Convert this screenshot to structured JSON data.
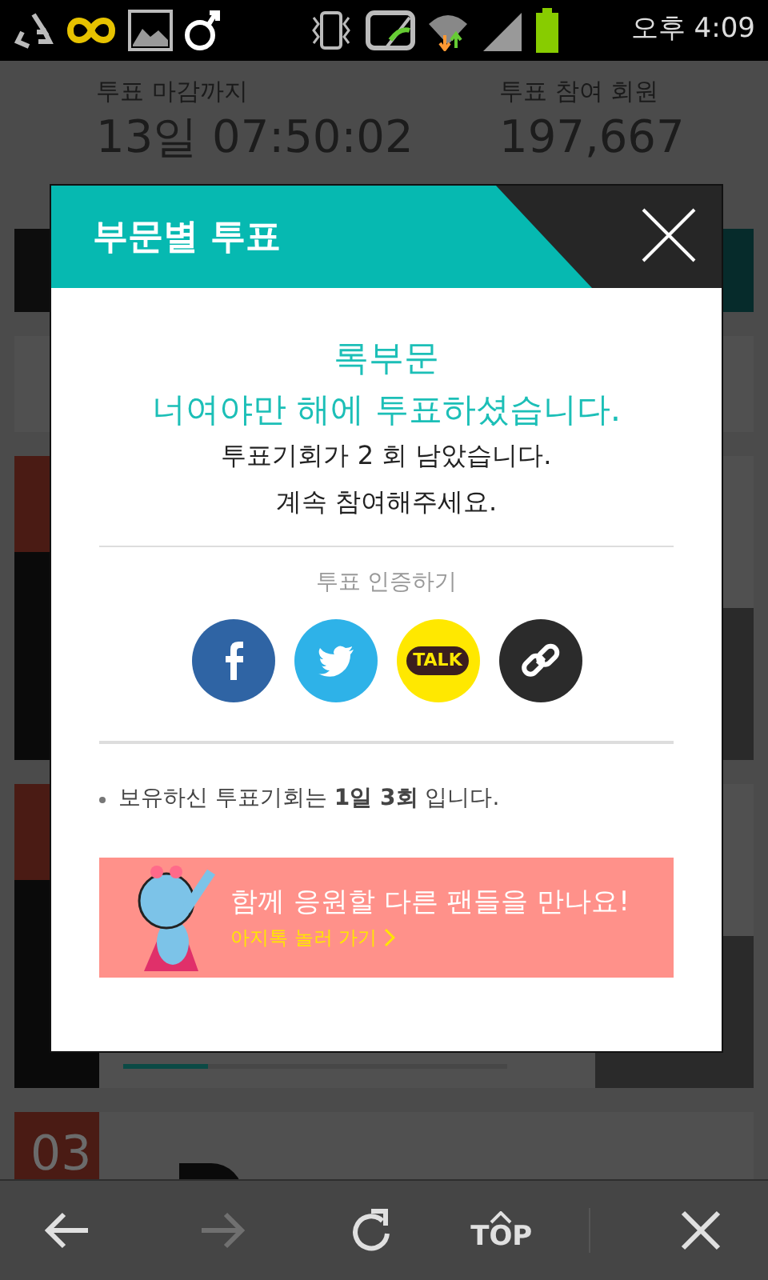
{
  "status_bar": {
    "time": "오후 4:09"
  },
  "stats": [
    {
      "label": "투표 마감까지",
      "value": "13일 07:50:02"
    },
    {
      "label": "투표 참여 회원",
      "value": "197,667"
    }
  ],
  "background_list": {
    "ranks": [
      "03"
    ],
    "progress": {
      "level": 0.22
    }
  },
  "modal": {
    "title": "부문별 투표",
    "category": "록부문",
    "voted_message": "너여야만 해에 투표하셨습니다.",
    "remaining": "투표기회가 2 회 남았습니다.",
    "encourage": "계속 참여해주세요.",
    "share_label": "투표 인증하기",
    "share_buttons": [
      {
        "kind": "facebook"
      },
      {
        "kind": "twitter"
      },
      {
        "kind": "kakaotalk",
        "text": "TALK"
      },
      {
        "kind": "link"
      }
    ],
    "note": "보유하신 투표기회는 **1일 3회** 입니다.",
    "banner": {
      "headline": "함께 응원할 다른 팬들을 만나요!",
      "link": "아지톡 놀러 가기"
    }
  },
  "toolbar": {
    "buttons": [
      {
        "kind": "back",
        "disabled": false
      },
      {
        "kind": "forward",
        "disabled": true
      },
      {
        "kind": "refresh",
        "disabled": false
      },
      {
        "kind": "top",
        "text": "TOP",
        "disabled": false
      },
      {
        "kind": "close",
        "disabled": false
      }
    ]
  }
}
